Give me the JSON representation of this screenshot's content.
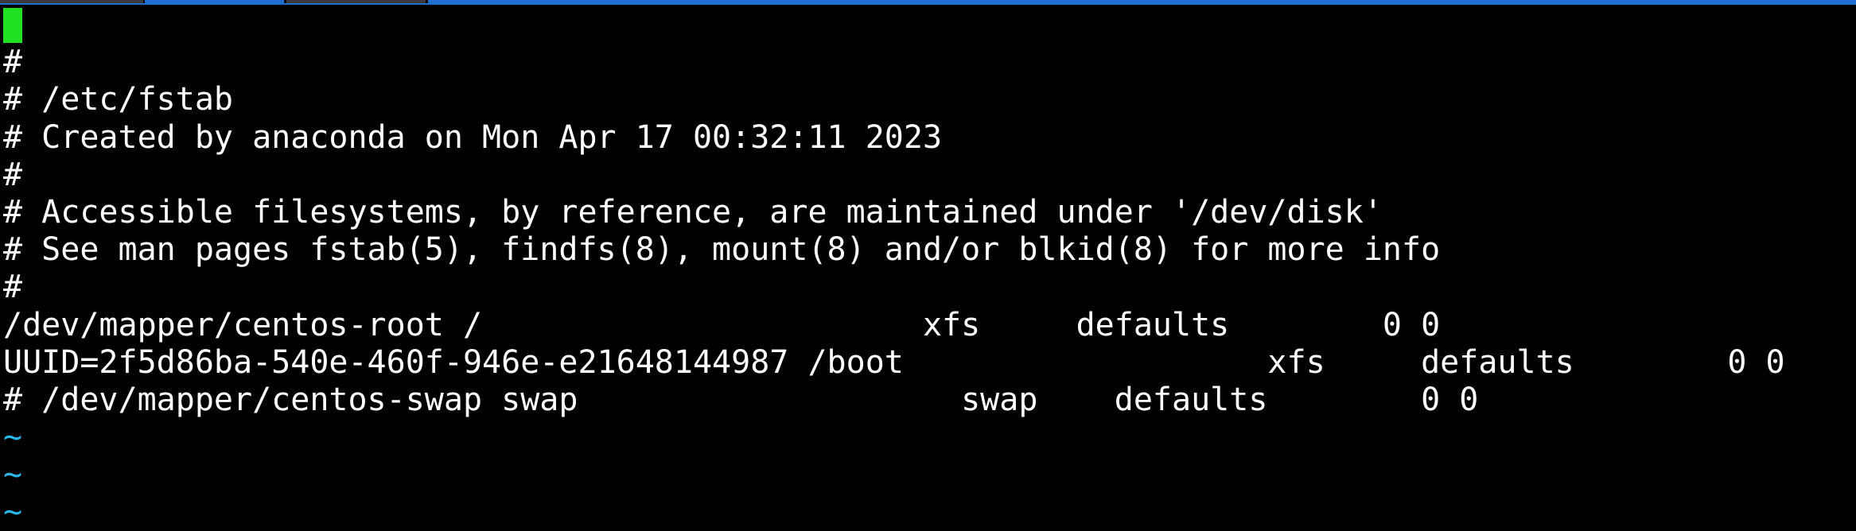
{
  "colors": {
    "background": "#000000",
    "text": "#ffffff",
    "cursor": "#22e022",
    "tilde": "#2ab6e8",
    "tab_active": "#1f6fd0"
  },
  "editor": {
    "lines": [
      "",
      "#",
      "# /etc/fstab",
      "# Created by anaconda on Mon Apr 17 00:32:11 2023",
      "#",
      "# Accessible filesystems, by reference, are maintained under '/dev/disk'",
      "# See man pages fstab(5), findfs(8), mount(8) and/or blkid(8) for more info",
      "#",
      "/dev/mapper/centos-root /                       xfs     defaults        0 0",
      "UUID=2f5d86ba-540e-460f-946e-e21648144987 /boot                   xfs     defaults        0 0",
      "# /dev/mapper/centos-swap swap                    swap    defaults        0 0"
    ],
    "empty_marker": "~"
  }
}
